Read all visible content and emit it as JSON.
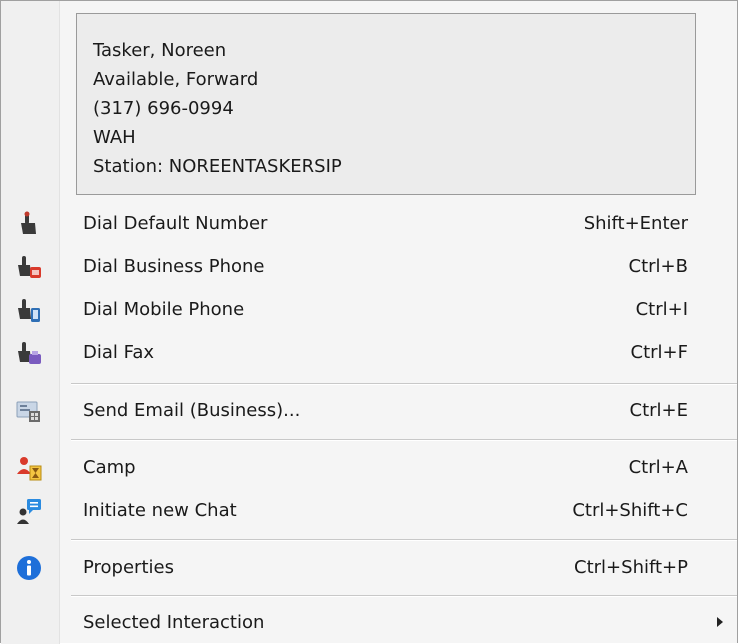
{
  "info": {
    "name": "Tasker, Noreen",
    "status": "Available, Forward",
    "phone": "(317) 696-0994",
    "location": "WAH",
    "station": "Station: NOREENTASKERSIP"
  },
  "menu": {
    "items": [
      {
        "label": "Dial Default Number",
        "shortcut": "Shift+Enter",
        "icon": "dial-hand-icon"
      },
      {
        "label": "Dial Business Phone",
        "shortcut": "Ctrl+B",
        "icon": "dial-business-phone-icon"
      },
      {
        "label": "Dial Mobile Phone",
        "shortcut": "Ctrl+I",
        "icon": "dial-mobile-phone-icon"
      },
      {
        "label": "Dial Fax",
        "shortcut": "Ctrl+F",
        "icon": "dial-fax-icon"
      },
      {
        "label": "Send Email (Business)...",
        "shortcut": "Ctrl+E",
        "icon": "email-card-icon"
      },
      {
        "label": "Camp",
        "shortcut": "Ctrl+A",
        "icon": "camp-hourglass-icon"
      },
      {
        "label": "Initiate new Chat",
        "shortcut": "Ctrl+Shift+C",
        "icon": "chat-user-icon"
      },
      {
        "label": "Properties",
        "shortcut": "Ctrl+Shift+P",
        "icon": "info-icon"
      },
      {
        "label": "Selected Interaction",
        "shortcut": "",
        "icon": "submenu-arrow-icon"
      }
    ]
  },
  "colors": {
    "hand": "#3a3a3a",
    "hand_tip": "#c0392b",
    "business": "#d93a2b",
    "mobile": "#2f6fb5",
    "fax": "#7a5bbf",
    "info_blue": "#1e6fd9",
    "chat_blue": "#2a8be0"
  }
}
